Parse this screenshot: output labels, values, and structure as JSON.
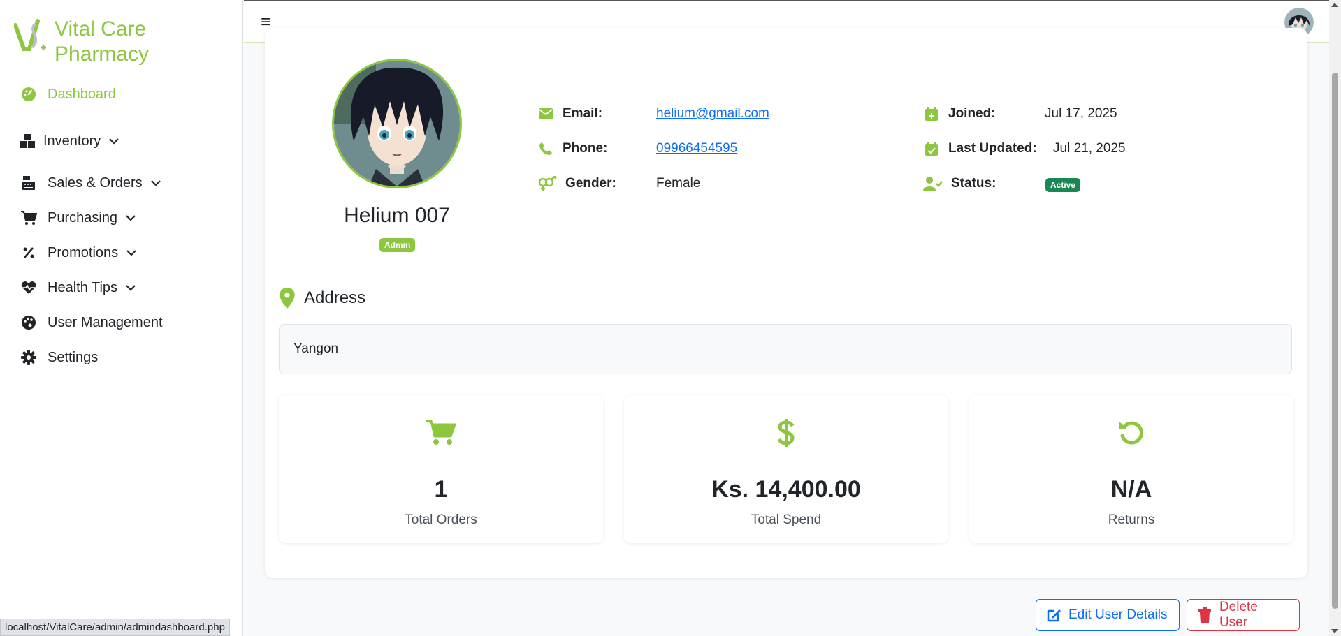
{
  "brand": {
    "name_line1": "Vital Care",
    "name_line2": "Pharmacy"
  },
  "sidebar": {
    "items": [
      {
        "label": "Dashboard",
        "icon": "gauge-icon",
        "active": true,
        "expandable": false
      },
      {
        "label": "Inventory",
        "icon": "boxes-icon",
        "active": false,
        "expandable": true
      },
      {
        "label": "Sales & Orders",
        "icon": "cash-register-icon",
        "active": false,
        "expandable": true
      },
      {
        "label": "Purchasing",
        "icon": "cart-icon",
        "active": false,
        "expandable": true
      },
      {
        "label": "Promotions",
        "icon": "percent-icon",
        "active": false,
        "expandable": true
      },
      {
        "label": "Health Tips",
        "icon": "heartbeat-icon",
        "active": false,
        "expandable": true
      },
      {
        "label": "User Management",
        "icon": "palette-icon",
        "active": false,
        "expandable": false
      },
      {
        "label": "Settings",
        "icon": "gear-icon",
        "active": false,
        "expandable": false
      }
    ]
  },
  "topbar": {
    "menu_glyph": "≡"
  },
  "profile": {
    "name": "Helium 007",
    "role": "Admin",
    "email_label": "Email:",
    "email": "helium@gmail.com",
    "phone_label": "Phone:",
    "phone": "09966454595",
    "gender_label": "Gender:",
    "gender": "Female",
    "joined_label": "Joined:",
    "joined": "Jul 17, 2025",
    "updated_label": "Last Updated:",
    "updated": "Jul 21, 2025",
    "status_label": "Status:",
    "status": "Active"
  },
  "address": {
    "heading": "Address",
    "value": "Yangon"
  },
  "stats": [
    {
      "value": "1",
      "label": "Total Orders",
      "icon": "cart-icon"
    },
    {
      "value": "Ks. 14,400.00",
      "label": "Total Spend",
      "icon": "dollar-icon"
    },
    {
      "value": "N/A",
      "label": "Returns",
      "icon": "undo-icon"
    }
  ],
  "actions": {
    "edit_label": "Edit User Details",
    "delete_label": "Delete User"
  },
  "status_bar": {
    "url": "localhost/VitalCare/admin/admindashboard.php"
  },
  "colors": {
    "brand": "#8dc63f",
    "primary": "#0d6efd",
    "danger": "#dc3545",
    "success": "#198754"
  }
}
